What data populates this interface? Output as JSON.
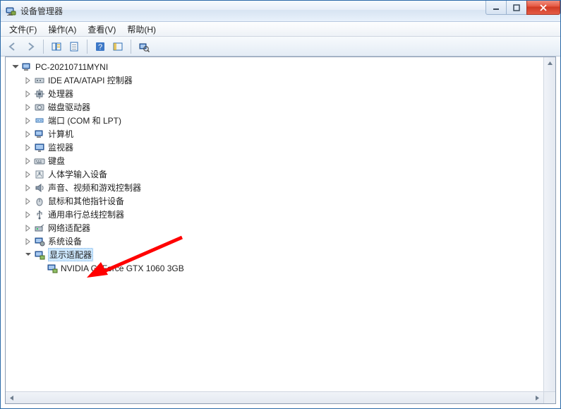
{
  "window": {
    "title": "设备管理器"
  },
  "menus": {
    "file": "文件(F)",
    "action": "操作(A)",
    "view": "查看(V)",
    "help": "帮助(H)"
  },
  "tree": {
    "root": "PC-20210711MYNI",
    "items": [
      "IDE ATA/ATAPI 控制器",
      "处理器",
      "磁盘驱动器",
      "端口 (COM 和 LPT)",
      "计算机",
      "监视器",
      "键盘",
      "人体学输入设备",
      "声音、视频和游戏控制器",
      "鼠标和其他指针设备",
      "通用串行总线控制器",
      "网络适配器",
      "系统设备"
    ],
    "display_adapters_label": "显示适配器",
    "display_adapter_child": "NVIDIA GeForce GTX 1060 3GB"
  }
}
